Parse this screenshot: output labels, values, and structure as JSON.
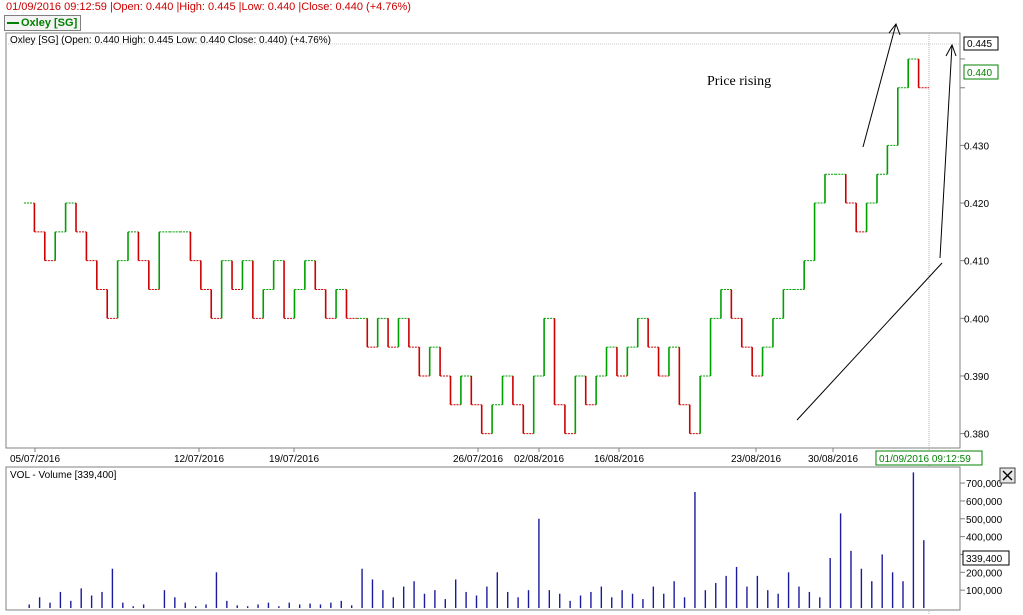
{
  "header": {
    "status": "01/09/2016 09:12:59 |Open: 0.440 |High: 0.445 |Low: 0.440 |Close: 0.440 (+4.76%)",
    "symbol": "Oxley [SG]"
  },
  "colors": {
    "up": "#00a000",
    "down": "#cc0000",
    "volume": "#1a1a9c",
    "axis": "#808080"
  },
  "chart_data": [
    {
      "type": "line",
      "legend": "Oxley [SG] (Open: 0.440  High: 0.445  Low: 0.440  Close: 0.440) (+4.76%)",
      "ylim": [
        0.3775,
        0.4495
      ],
      "yticks": [
        0.38,
        0.39,
        0.4,
        0.41,
        0.42,
        0.43,
        0.44,
        0.445
      ],
      "ytick_labels": [
        "0.380",
        "0.390",
        "0.400",
        "0.410",
        "0.420",
        "0.430",
        "",
        ""
      ],
      "xticks": [
        "05/07/2016",
        "12/07/2016",
        "19/07/2016",
        "26/07/2016",
        "02/08/2016",
        "16/08/2016",
        "23/08/2016",
        "30/08/2016"
      ],
      "cursor_time": "01/09/2016 09:12:59",
      "last_price": "0.440",
      "high_marker": "0.445",
      "annotation": "Price rising",
      "series": [
        {
          "values": [
            0.42,
            0.415,
            0.41,
            0.415,
            0.42,
            0.415,
            0.41,
            0.405,
            0.4,
            0.41,
            0.415,
            0.41,
            0.405,
            0.415,
            0.415,
            0.415,
            0.41,
            0.405,
            0.4,
            0.41,
            0.405,
            0.41,
            0.4,
            0.405,
            0.41,
            0.4,
            0.405,
            0.41,
            0.405,
            0.4,
            0.405,
            0.4,
            0.4,
            0.395,
            0.4,
            0.395,
            0.4,
            0.395,
            0.39,
            0.395,
            0.39,
            0.385,
            0.39,
            0.385,
            0.38,
            0.385,
            0.39,
            0.385,
            0.38,
            0.39,
            0.4,
            0.385,
            0.38,
            0.39,
            0.385,
            0.39,
            0.395,
            0.39,
            0.395,
            0.4,
            0.395,
            0.39,
            0.395,
            0.385,
            0.38,
            0.39,
            0.4,
            0.405,
            0.4,
            0.395,
            0.39,
            0.395,
            0.4,
            0.405,
            0.405,
            0.41,
            0.42,
            0.425,
            0.425,
            0.42,
            0.415,
            0.42,
            0.425,
            0.43,
            0.44,
            0.445,
            0.44
          ]
        }
      ]
    },
    {
      "type": "bar",
      "legend": "VOL - Volume [339,400]",
      "ylim": [
        0,
        790000
      ],
      "yticks": [
        100000,
        200000,
        300000,
        400000,
        500000,
        600000,
        700000
      ],
      "ytick_labels": [
        "100,000",
        "200,000",
        "300,000",
        "400,000",
        "500,000",
        "600,000",
        "700,000"
      ],
      "current": "339,400",
      "series": [
        {
          "values": [
            20000,
            60000,
            30000,
            90000,
            40000,
            110000,
            70000,
            90000,
            220000,
            30000,
            10000,
            20000,
            0,
            100000,
            60000,
            30000,
            10000,
            20000,
            200000,
            40000,
            15000,
            10000,
            20000,
            30000,
            10000,
            30000,
            20000,
            25000,
            20000,
            30000,
            40000,
            15000,
            220000,
            160000,
            100000,
            60000,
            120000,
            150000,
            80000,
            100000,
            50000,
            160000,
            90000,
            70000,
            120000,
            200000,
            90000,
            60000,
            100000,
            500000,
            100000,
            80000,
            40000,
            70000,
            90000,
            120000,
            60000,
            100000,
            80000,
            50000,
            120000,
            80000,
            150000,
            60000,
            650000,
            100000,
            140000,
            180000,
            230000,
            120000,
            180000,
            100000,
            80000,
            200000,
            120000,
            90000,
            60000,
            280000,
            530000,
            320000,
            220000,
            150000,
            300000,
            200000,
            150000,
            760000,
            380000
          ]
        }
      ]
    }
  ]
}
